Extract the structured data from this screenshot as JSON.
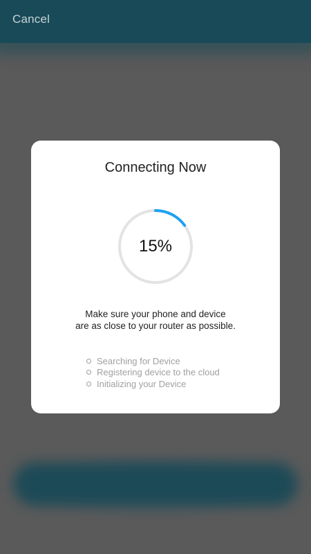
{
  "header": {
    "cancel_label": "Cancel"
  },
  "modal": {
    "title": "Connecting Now",
    "progress": {
      "percent": 15,
      "label": "15%"
    },
    "message_line1": "Make sure your phone and device",
    "message_line2": "are as close to your router as possible.",
    "steps": [
      {
        "label": "Searching for Device"
      },
      {
        "label": "Registering device to the cloud"
      },
      {
        "label": "Initializing your Device"
      }
    ]
  },
  "colors": {
    "header_bg": "#184a58",
    "overlay_bg": "#5a5a5a",
    "progress_accent": "#1da1f2",
    "progress_track": "#e3e3e3"
  },
  "icons": {
    "step_bullet": "hollow-circle-icon"
  }
}
